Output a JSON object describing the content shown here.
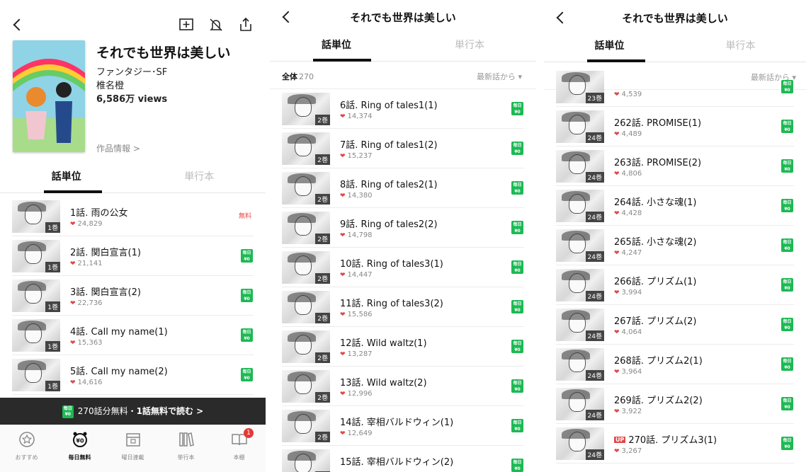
{
  "series_title": "それでも世界は美しい",
  "genre": "ファンタジー･SF",
  "author": "椎名橙",
  "views": "6,586万 views",
  "info_link": "作品情報 >",
  "tabs": {
    "episodes": "話単位",
    "volumes": "単行本"
  },
  "count_label": "全体",
  "count_value": "270",
  "sort_label": "最新話から",
  "free_label": "無料",
  "daily_badge": "毎日\n¥0",
  "up_label": "UP",
  "promo": {
    "badge": "毎日\n¥0",
    "text": "270話分無料・",
    "bold": "1話無料で読む >"
  },
  "nav": [
    {
      "label": "おすすめ"
    },
    {
      "label": "毎日無料"
    },
    {
      "label": "曜日連載"
    },
    {
      "label": "単行本"
    },
    {
      "label": "本棚",
      "badge": "1"
    }
  ],
  "panel1_episodes": [
    {
      "title": "1話. 雨の公女",
      "likes": "24,829",
      "vol": "1巻",
      "status": "free"
    },
    {
      "title": "2話. 関白宣言(1)",
      "likes": "21,141",
      "vol": "1巻",
      "status": "daily"
    },
    {
      "title": "3話. 関白宣言(2)",
      "likes": "22,736",
      "vol": "1巻",
      "status": "daily"
    },
    {
      "title": "4話. Call my name(1)",
      "likes": "15,363",
      "vol": "1巻",
      "status": "daily"
    },
    {
      "title": "5話. Call my name(2)",
      "likes": "14,616",
      "vol": "1巻",
      "status": "daily"
    }
  ],
  "panel2_episodes": [
    {
      "title": "6話. Ring of tales1(1)",
      "likes": "14,374",
      "vol": "2巻"
    },
    {
      "title": "7話. Ring of tales1(2)",
      "likes": "15,237",
      "vol": "2巻"
    },
    {
      "title": "8話. Ring of tales2(1)",
      "likes": "14,380",
      "vol": "2巻"
    },
    {
      "title": "9話. Ring of tales2(2)",
      "likes": "14,798",
      "vol": "2巻"
    },
    {
      "title": "10話. Ring of tales3(1)",
      "likes": "14,447",
      "vol": "2巻"
    },
    {
      "title": "11話. Ring of tales3(2)",
      "likes": "15,586",
      "vol": "2巻"
    },
    {
      "title": "12話. Wild waltz(1)",
      "likes": "13,287",
      "vol": "2巻"
    },
    {
      "title": "13話. Wild waltz(2)",
      "likes": "12,996",
      "vol": "2巻"
    },
    {
      "title": "14話. 宰相バルドウィン(1)",
      "likes": "12,649",
      "vol": "2巻"
    },
    {
      "title": "15話. 宰相バルドウィン(2)",
      "likes": "",
      "vol": "2巻"
    }
  ],
  "panel3_episodes": [
    {
      "title": "",
      "likes": "4,539",
      "vol": "23巻"
    },
    {
      "title": "262話. PROMISE(1)",
      "likes": "4,489",
      "vol": "24巻"
    },
    {
      "title": "263話. PROMISE(2)",
      "likes": "4,806",
      "vol": "24巻"
    },
    {
      "title": "264話. 小さな魂(1)",
      "likes": "4,428",
      "vol": "24巻"
    },
    {
      "title": "265話. 小さな魂(2)",
      "likes": "4,247",
      "vol": "24巻"
    },
    {
      "title": "266話. プリズム(1)",
      "likes": "3,994",
      "vol": "24巻"
    },
    {
      "title": "267話. プリズム(2)",
      "likes": "4,064",
      "vol": "24巻"
    },
    {
      "title": "268話. プリズム2(1)",
      "likes": "3,964",
      "vol": "24巻"
    },
    {
      "title": "269話. プリズム2(2)",
      "likes": "3,922",
      "vol": "24巻"
    },
    {
      "title": "270話. プリズム3(1)",
      "likes": "3,267",
      "vol": "24巻",
      "up": true
    }
  ]
}
